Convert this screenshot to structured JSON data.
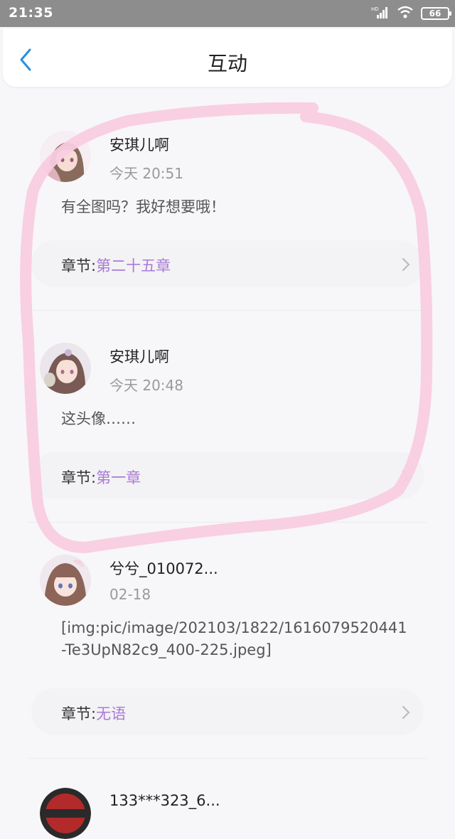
{
  "status_bar": {
    "time": "21:35",
    "battery": "66",
    "network": "HD"
  },
  "header": {
    "title": "互动"
  },
  "chapter_prefix": "章节:",
  "comments": [
    {
      "user": "安琪儿啊",
      "time": "今天 20:51",
      "content": "有全图吗？我好想要哦！",
      "chapter": "第二十五章"
    },
    {
      "user": "安琪儿啊",
      "time": "今天 20:48",
      "content": "这头像……",
      "chapter": "第一章"
    },
    {
      "user": "兮兮_010072...",
      "time": "02-18",
      "content": "[img:pic/image/202103/1822/1616079520441-Te3UpN82c9_400-225.jpeg]",
      "chapter": "无语"
    },
    {
      "user": "133***323_6..."
    }
  ],
  "colors": {
    "accent": "#2a8ee0",
    "chapter": "#a97bd6",
    "highlight_ring": "#f9cce0"
  }
}
